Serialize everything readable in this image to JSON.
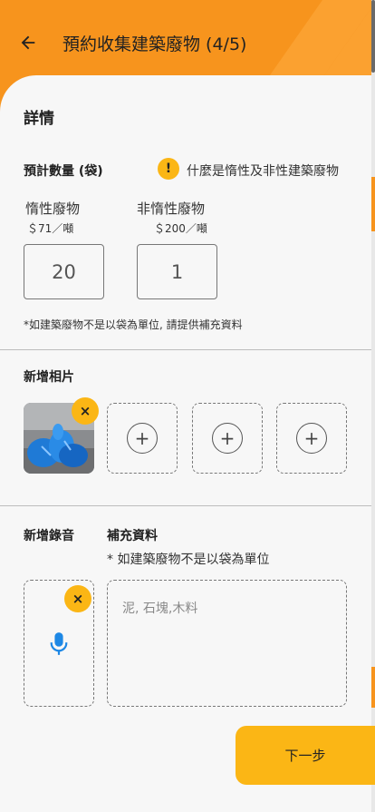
{
  "header": {
    "title": "預約收集建築廢物 (4/5)"
  },
  "details": {
    "heading": "詳情",
    "qty_label": "預計數量 (袋)",
    "info_link": "什麼是惰性及非性建築廢物",
    "inert": {
      "label": "惰性廢物",
      "price": "＄71／噸",
      "value": "20"
    },
    "non_inert": {
      "label": "非惰性廢物",
      "price": "＄200／噸",
      "value": "1"
    },
    "note": "*如建築廢物不是以袋為單位, 請提供補充資料"
  },
  "photos": {
    "heading": "新增相片"
  },
  "audio": {
    "heading": "新增錄音"
  },
  "supplement": {
    "heading": "補充資料",
    "hint": "* 如建築廢物不是以袋為單位",
    "placeholder": "泥, 石塊,木料"
  },
  "footer": {
    "next_label": "下一步"
  },
  "colors": {
    "brand_orange": "#f7941d",
    "accent_yellow": "#fbb615",
    "mic_blue": "#1e88e5"
  }
}
